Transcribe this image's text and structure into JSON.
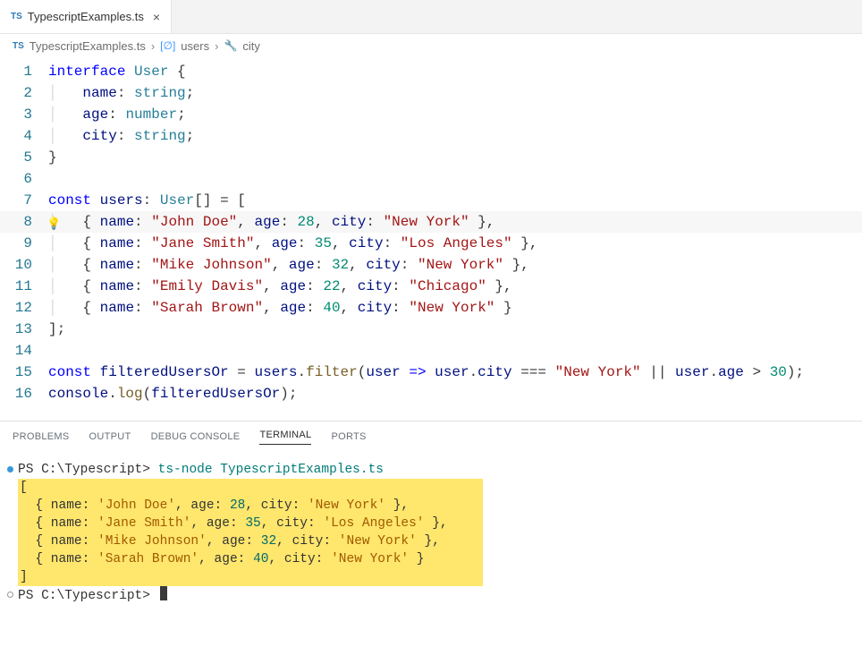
{
  "tab": {
    "badge": "TS",
    "filename": "TypescriptExamples.ts",
    "close_glyph": "×"
  },
  "breadcrumb": {
    "file_badge": "TS",
    "file": "TypescriptExamples.ts",
    "sym1": "users",
    "sym2": "city"
  },
  "code": {
    "lines": [
      {
        "n": "1",
        "html": "<span class='kw'>interface</span> <span class='type'>User</span> <span class='punc'>{</span>"
      },
      {
        "n": "2",
        "html": "<span class='guide'>│</span>   <span class='ident'>name</span><span class='punc'>:</span> <span class='type'>string</span><span class='punc'>;</span>"
      },
      {
        "n": "3",
        "html": "<span class='guide'>│</span>   <span class='ident'>age</span><span class='punc'>:</span> <span class='type'>number</span><span class='punc'>;</span>"
      },
      {
        "n": "4",
        "html": "<span class='guide'>│</span>   <span class='ident'>city</span><span class='punc'>:</span> <span class='type'>string</span><span class='punc'>;</span>"
      },
      {
        "n": "5",
        "html": "<span class='punc'>}</span>"
      },
      {
        "n": "6",
        "html": ""
      },
      {
        "n": "7",
        "html": "<span class='kw'>const</span> <span class='ident'>users</span><span class='punc'>:</span> <span class='type'>User</span><span class='punc'>[]</span> <span class='op'>=</span> <span class='punc'>[</span>"
      },
      {
        "n": "8",
        "hl": true,
        "bulb": true,
        "html": "<span class='guide'>│</span>   <span class='punc'>{</span> <span class='ident'>name</span><span class='punc'>:</span> <span class='str'>\"John Doe\"</span><span class='punc'>,</span> <span class='ident'>age</span><span class='punc'>:</span> <span class='num'>28</span><span class='punc'>,</span> <span class='ident'>city</span><span class='punc'>:</span> <span class='str'>\"New York\"</span> <span class='punc'>},</span>"
      },
      {
        "n": "9",
        "html": "<span class='guide'>│</span>   <span class='punc'>{</span> <span class='ident'>name</span><span class='punc'>:</span> <span class='str'>\"Jane Smith\"</span><span class='punc'>,</span> <span class='ident'>age</span><span class='punc'>:</span> <span class='num'>35</span><span class='punc'>,</span> <span class='ident'>city</span><span class='punc'>:</span> <span class='str'>\"Los Angeles\"</span> <span class='punc'>},</span>"
      },
      {
        "n": "10",
        "html": "<span class='guide'>│</span>   <span class='punc'>{</span> <span class='ident'>name</span><span class='punc'>:</span> <span class='str'>\"Mike Johnson\"</span><span class='punc'>,</span> <span class='ident'>age</span><span class='punc'>:</span> <span class='num'>32</span><span class='punc'>,</span> <span class='ident'>city</span><span class='punc'>:</span> <span class='str'>\"New York\"</span> <span class='punc'>},</span>"
      },
      {
        "n": "11",
        "html": "<span class='guide'>│</span>   <span class='punc'>{</span> <span class='ident'>name</span><span class='punc'>:</span> <span class='str'>\"Emily Davis\"</span><span class='punc'>,</span> <span class='ident'>age</span><span class='punc'>:</span> <span class='num'>22</span><span class='punc'>,</span> <span class='ident'>city</span><span class='punc'>:</span> <span class='str'>\"Chicago\"</span> <span class='punc'>},</span>"
      },
      {
        "n": "12",
        "html": "<span class='guide'>│</span>   <span class='punc'>{</span> <span class='ident'>name</span><span class='punc'>:</span> <span class='str'>\"Sarah Brown\"</span><span class='punc'>,</span> <span class='ident'>age</span><span class='punc'>:</span> <span class='num'>40</span><span class='punc'>,</span> <span class='ident'>city</span><span class='punc'>:</span> <span class='str'>\"New York\"</span> <span class='punc'>}</span>"
      },
      {
        "n": "13",
        "html": "<span class='punc'>];</span>"
      },
      {
        "n": "14",
        "html": ""
      },
      {
        "n": "15",
        "html": "<span class='kw'>const</span> <span class='ident'>filteredUsersOr</span> <span class='op'>=</span> <span class='ident'>users</span><span class='punc'>.</span><span class='fn'>filter</span><span class='punc'>(</span><span class='ident'>user</span> <span class='kw'>=&gt;</span> <span class='ident'>user</span><span class='punc'>.</span><span class='ident'>city</span> <span class='op'>===</span> <span class='str'>\"New York\"</span> <span class='op'>||</span> <span class='ident'>user</span><span class='punc'>.</span><span class='ident'>age</span> <span class='op'>&gt;</span> <span class='num'>30</span><span class='punc'>);</span>"
      },
      {
        "n": "16",
        "html": "<span class='ident'>console</span><span class='punc'>.</span><span class='fn'>log</span><span class='punc'>(</span><span class='ident'>filteredUsersOr</span><span class='punc'>);</span>"
      }
    ]
  },
  "panel": {
    "tabs": {
      "problems": "PROBLEMS",
      "output": "OUTPUT",
      "debug": "DEBUG CONSOLE",
      "terminal": "TERMINAL",
      "ports": "PORTS"
    }
  },
  "terminal": {
    "prompt1_path": "PS C:\\Typescript>",
    "prompt1_cmd": "ts-node TypescriptExamples.ts",
    "output_lines": [
      "[",
      "  { name: <span class='str2'>'John Doe'</span>, age: <span class='num2'>28</span>, city: <span class='str2'>'New York'</span> },",
      "  { name: <span class='str2'>'Jane Smith'</span>, age: <span class='num2'>35</span>, city: <span class='str2'>'Los Angeles'</span> },",
      "  { name: <span class='str2'>'Mike Johnson'</span>, age: <span class='num2'>32</span>, city: <span class='str2'>'New York'</span> },",
      "  { name: <span class='str2'>'Sarah Brown'</span>, age: <span class='num2'>40</span>, city: <span class='str2'>'New York'</span> }",
      "]"
    ],
    "prompt2_path": "PS C:\\Typescript>"
  }
}
